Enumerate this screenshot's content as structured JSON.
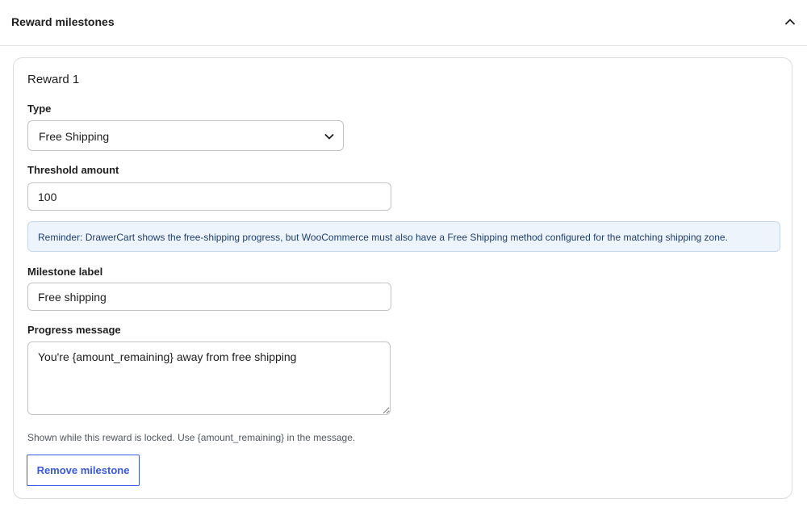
{
  "section": {
    "title": "Reward milestones",
    "toggle_icon": "chevron-up-icon"
  },
  "reward": {
    "title": "Reward 1",
    "type": {
      "label": "Type",
      "value": "Free Shipping",
      "icon": "chevron-down-icon"
    },
    "threshold": {
      "label": "Threshold amount",
      "value": "100"
    },
    "notice": "Reminder: DrawerCart shows the free-shipping progress, but WooCommerce must also have a Free Shipping method configured for the matching shipping zone.",
    "milestone_label": {
      "label": "Milestone label",
      "value": "Free shipping"
    },
    "progress_message": {
      "label": "Progress message",
      "value": "You're {amount_remaining} away from free shipping",
      "help": "Shown while this reward is locked. Use {amount_remaining} in the message."
    },
    "remove_button": "Remove milestone"
  },
  "colors": {
    "accent": "#3858e9",
    "notice_bg": "#eef4fc",
    "notice_text": "#1d3f73"
  }
}
